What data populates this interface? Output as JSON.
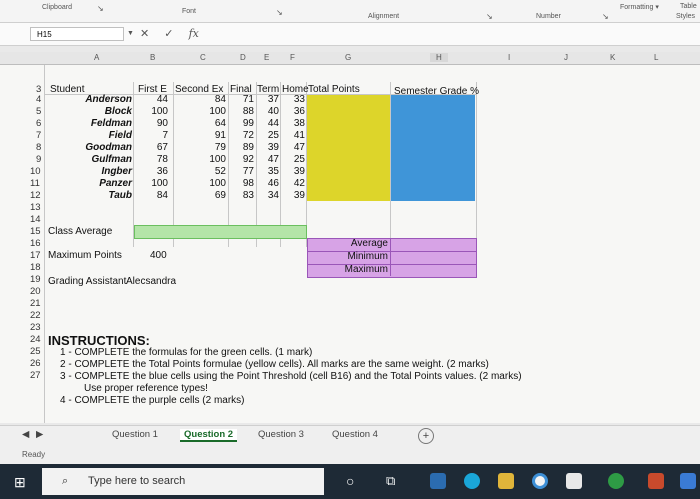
{
  "ribbon": {
    "clipboard": "Clipboard",
    "font": "Font",
    "alignment": "Alignment",
    "number": "Number",
    "formatting": "Formatting ▾",
    "table": "Table",
    "styles": "Styles"
  },
  "formula_bar": {
    "name_box": "H15",
    "cancel": "✕",
    "enter": "✓",
    "fx": "fx"
  },
  "columns": [
    "A",
    "B",
    "C",
    "D",
    "E",
    "F",
    "G",
    "H",
    "I",
    "J",
    "K",
    "L"
  ],
  "rows": [
    "3",
    "4",
    "5",
    "6",
    "7",
    "8",
    "9",
    "10",
    "11",
    "12",
    "13",
    "14",
    "15",
    "16",
    "17",
    "18",
    "19",
    "20",
    "21",
    "22",
    "23",
    "24",
    "25",
    "26",
    "27"
  ],
  "header": {
    "student": "Student",
    "first_exam": "First E",
    "second_exam": "Second Ex",
    "final": "Final",
    "term": "Term",
    "home": "Home",
    "total_points": "Total Points",
    "semester_grade": "Semester Grade %"
  },
  "students": [
    {
      "name": "Anderson",
      "first": "44",
      "second": "84",
      "final": "71",
      "term": "37",
      "home": "33"
    },
    {
      "name": "Block",
      "first": "100",
      "second": "100",
      "final": "88",
      "term": "40",
      "home": "36"
    },
    {
      "name": "Feldman",
      "first": "90",
      "second": "64",
      "final": "99",
      "term": "44",
      "home": "38"
    },
    {
      "name": "Field",
      "first": "7",
      "second": "91",
      "final": "72",
      "term": "25",
      "home": "41"
    },
    {
      "name": "Goodman",
      "first": "67",
      "second": "79",
      "final": "89",
      "term": "39",
      "home": "47"
    },
    {
      "name": "Gulfman",
      "first": "78",
      "second": "100",
      "final": "92",
      "term": "47",
      "home": "25"
    },
    {
      "name": "Ingber",
      "first": "36",
      "second": "52",
      "final": "77",
      "term": "35",
      "home": "39"
    },
    {
      "name": "Panzer",
      "first": "100",
      "second": "100",
      "final": "98",
      "term": "46",
      "home": "42"
    },
    {
      "name": "Taub",
      "first": "84",
      "second": "69",
      "final": "83",
      "term": "34",
      "home": "39"
    }
  ],
  "class_average_label": "Class Average",
  "max_points_label": "Maximum Points",
  "max_points_value": "400",
  "grading_assistant_label": "Grading Assistant",
  "grading_assistant_value": "Alecsandra",
  "stats": [
    "Average",
    "Minimum",
    "Maximum"
  ],
  "instructions": {
    "title": "INSTRUCTIONS:",
    "lines": [
      "1 - COMPLETE the formulas for the green cells. (1 mark)",
      "2 - COMPLETE the Total Points formulae (yellow cells). All marks are the same weight. (2 marks)",
      "3 - COMPLETE the blue cells using the Point Threshold (cell B16) and the Total Points values. (2 marks)",
      "Use proper reference types!",
      "4 - COMPLETE the purple cells (2 marks)"
    ]
  },
  "sheet_tabs": [
    "Question 1",
    "Question 2",
    "Question 3",
    "Question 4"
  ],
  "active_tab": "Question 2",
  "status": "Ready",
  "taskbar": {
    "search_placeholder": "Type here to search"
  }
}
